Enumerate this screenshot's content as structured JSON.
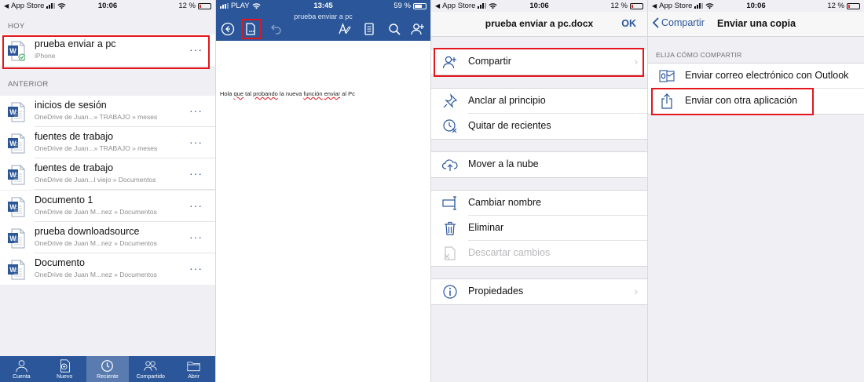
{
  "panel1": {
    "status": {
      "back_app": "App Store",
      "time": "10:06",
      "battery": "12 %"
    },
    "section_today": "HOY",
    "section_earlier": "ANTERIOR",
    "files_today": [
      {
        "name": "prueba enviar a pc",
        "path": "iPhone"
      }
    ],
    "files_earlier": [
      {
        "name": "inicios de sesión",
        "path": "OneDrive de Juan...» TRABAJO » meses"
      },
      {
        "name": "fuentes de trabajo",
        "path": "OneDrive de Juan...» TRABAJO » meses"
      },
      {
        "name": "fuentes de trabajo",
        "path": "OneDrive de Juan...l viejo » Documentos"
      },
      {
        "name": "Documento 1",
        "path": "OneDrive de Juan M...nez » Documentos"
      },
      {
        "name": "prueba downloadsource",
        "path": "OneDrive de Juan M...nez » Documentos"
      },
      {
        "name": "Documento",
        "path": "OneDrive de Juan M...nez » Documentos"
      }
    ],
    "more_label": "···",
    "tabs": [
      {
        "label": "Cuenta",
        "icon": "person-icon"
      },
      {
        "label": "Nuevo",
        "icon": "new-doc-icon"
      },
      {
        "label": "Reciente",
        "icon": "clock-icon",
        "active": true
      },
      {
        "label": "Compartido",
        "icon": "people-icon"
      },
      {
        "label": "Abrir",
        "icon": "folder-icon"
      }
    ]
  },
  "panel2": {
    "status": {
      "carrier": "PLAY",
      "time": "13:45",
      "battery": "59 %"
    },
    "doc_title": "prueba enviar a pc",
    "doc_text_parts": [
      "Hola ",
      "que",
      " tal ",
      "probando",
      " la nueva ",
      "función",
      " ",
      "enviar",
      " al Pc"
    ]
  },
  "panel3": {
    "status": {
      "back_app": "App Store",
      "time": "10:06",
      "battery": "12 %"
    },
    "title": "prueba enviar a pc.docx",
    "ok": "OK",
    "items": {
      "share": "Compartir",
      "pin": "Anclar al principio",
      "remove_recent": "Quitar de recientes",
      "move_cloud": "Mover a la nube",
      "rename": "Cambiar nombre",
      "delete": "Eliminar",
      "discard": "Descartar cambios",
      "properties": "Propiedades"
    }
  },
  "panel4": {
    "status": {
      "back_app": "App Store",
      "time": "10:06",
      "battery": "12 %"
    },
    "back": "Compartir",
    "title": "Enviar una copia",
    "header": "ELIJA CÓMO COMPARTIR",
    "options": {
      "outlook": "Enviar correo electrónico con Outlook",
      "other_app": "Enviar con otra aplicación"
    }
  },
  "colors": {
    "word_blue": "#2b579a",
    "highlight": "#e3161c",
    "background": "#efeff4"
  }
}
